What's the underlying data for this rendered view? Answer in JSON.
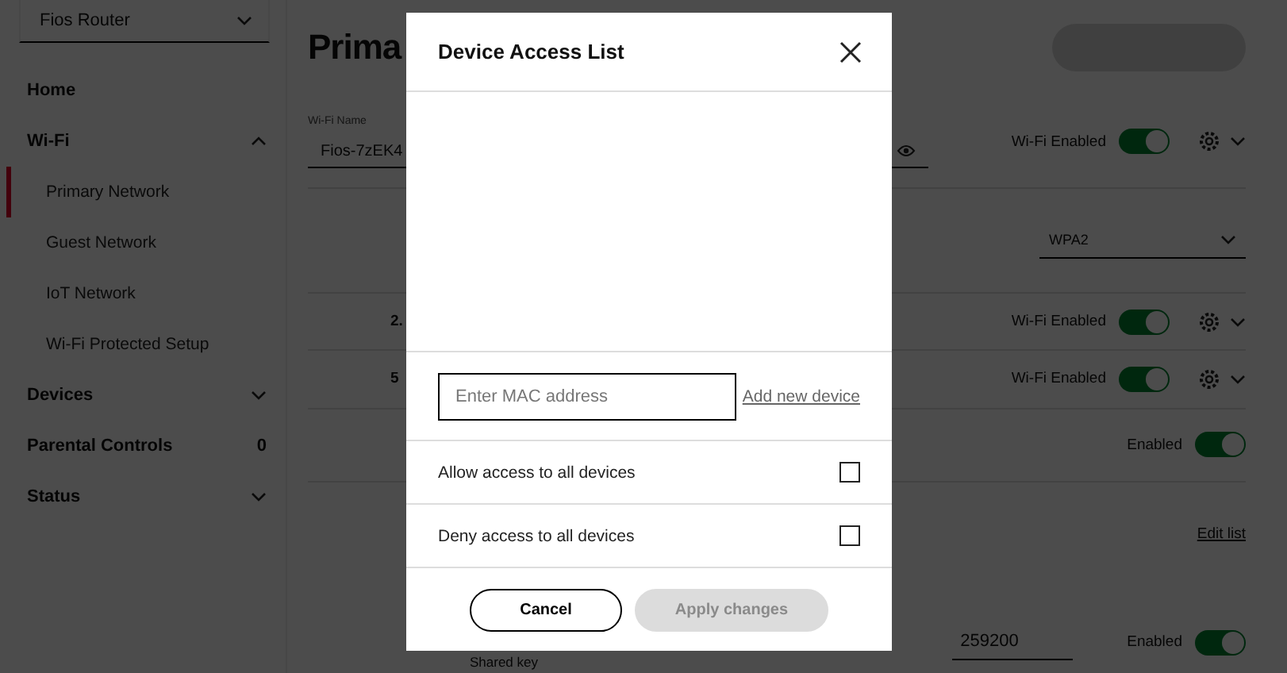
{
  "sidebar": {
    "router_select": {
      "value": "Fios Router"
    },
    "items": [
      {
        "label": "Home"
      },
      {
        "label": "Wi-Fi",
        "expanded": true,
        "children": [
          {
            "label": "Primary Network",
            "selected": true
          },
          {
            "label": "Guest Network",
            "selected": false
          },
          {
            "label": "IoT Network",
            "selected": false
          },
          {
            "label": "Wi-Fi Protected Setup",
            "selected": false
          }
        ]
      },
      {
        "label": "Devices",
        "expanded": false
      },
      {
        "label": "Parental Controls",
        "badge": "0"
      },
      {
        "label": "Status",
        "expanded": false
      }
    ]
  },
  "main": {
    "title": "Prima",
    "rows": [
      {
        "kind": "name",
        "field_label": "Wi-Fi Name",
        "field_value": "Fios-7zEK4",
        "toggle_label": "Wi-Fi Enabled",
        "on": true
      },
      {
        "kind": "select",
        "select_value": "WPA2"
      },
      {
        "kind": "band",
        "label": "2.",
        "toggle_label": "Wi-Fi Enabled",
        "on": true
      },
      {
        "kind": "band",
        "label": "5",
        "toggle_label": "Wi-Fi Enabled",
        "on": true
      },
      {
        "kind": "toggle",
        "toggle_label": "Enabled",
        "on": true
      },
      {
        "kind": "link",
        "link": "Edit list"
      },
      {
        "kind": "value",
        "value": "259200",
        "toggle_label": "Enabled",
        "on": true,
        "note": "Shared key"
      }
    ]
  },
  "modal": {
    "title": "Device Access List",
    "mac_field": {
      "placeholder": "Enter MAC address"
    },
    "add_link": "Add new device",
    "options": [
      {
        "label": "Allow access to all devices",
        "checked": false
      },
      {
        "label": "Deny access to all devices",
        "checked": false
      }
    ],
    "cancel": "Cancel",
    "apply": {
      "label": "Apply changes",
      "disabled": true
    }
  }
}
